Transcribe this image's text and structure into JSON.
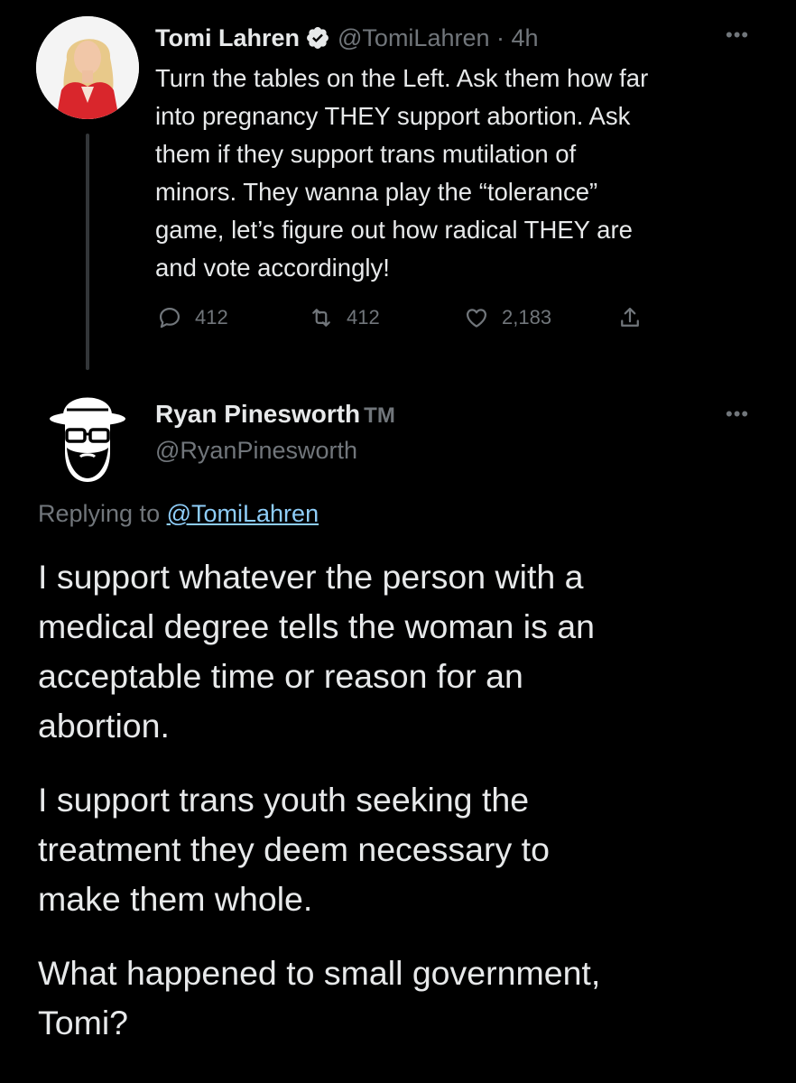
{
  "tweet": {
    "author_name": "Tomi Lahren",
    "handle_time": "@TomiLahren · 4h",
    "more": "•••",
    "text": "Turn the tables on the Left. Ask them how far\ninto pregnancy THEY support abortion. Ask\nthem if they support trans mutilation of\nminors. They wanna play the “tolerance”\ngame, let’s figure out how radical THEY are\nand vote accordingly!",
    "replies": "412",
    "retweets": "412",
    "likes": "2,183",
    "accent_color": "#1d9bf0"
  },
  "reply": {
    "author_name": "Ryan Pinesworth",
    "tm": "TM",
    "handle": "@RyanPinesworth",
    "more": "•••",
    "replying_prefix": "Replying to ",
    "replying_handle": "@TomiLahren",
    "paragraphs": [
      "I support whatever the person with a\nmedical degree tells the woman is an\nacceptable time or reason for an\nabortion.",
      "I support trans youth seeking the\ntreatment they deem necessary to\nmake them whole.",
      "What happened to small government,\nTomi?"
    ]
  }
}
